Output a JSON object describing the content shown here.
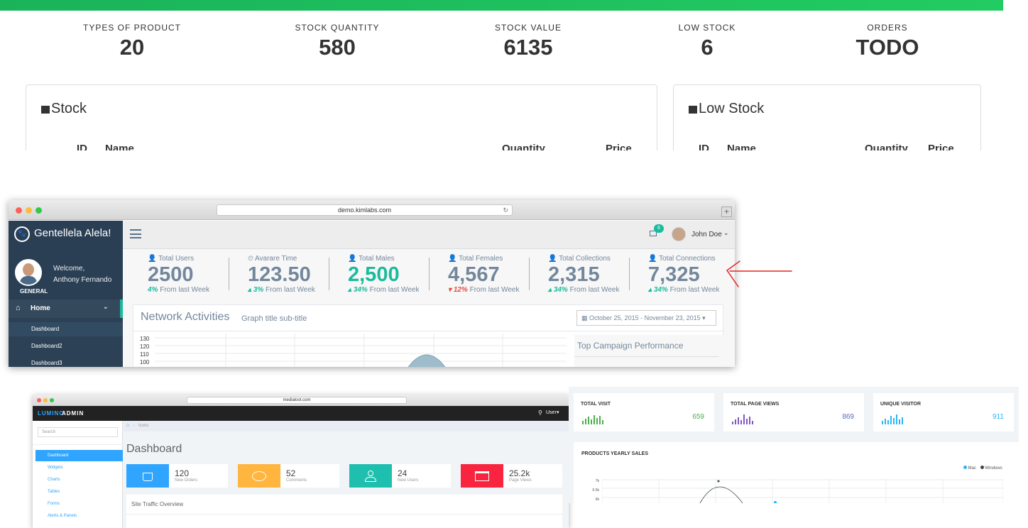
{
  "panel1": {
    "stats": [
      {
        "label": "TYPES OF PRODUCT",
        "value": "20"
      },
      {
        "label": "STOCK QUANTITY",
        "value": "580"
      },
      {
        "label": "STOCK VALUE",
        "value": "6135"
      },
      {
        "label": "LOW STOCK",
        "value": "6"
      },
      {
        "label": "ORDERS",
        "value": "TODO"
      }
    ],
    "stock_card": {
      "title": "Stock",
      "columns": [
        "ID",
        "Name",
        "Quantity",
        "Price"
      ]
    },
    "low_stock_card": {
      "title": "Low Stock",
      "columns": [
        "ID",
        "Name",
        "Quantity",
        "Price"
      ]
    },
    "colors": {
      "topbar": "#1ab35a"
    }
  },
  "panel2": {
    "url": "demo.kimlabs.com",
    "brand": "Gentellela Alela!",
    "welcome": "Welcome,",
    "user_name": "Anthony Fernando",
    "section": "GENERAL",
    "nav_home": "Home",
    "nav_items": [
      "Dashboard",
      "Dashboard2",
      "Dashboard3"
    ],
    "notif_count": "6",
    "top_user": "John Doe",
    "stats": [
      {
        "label": "Total Users",
        "value": "2500",
        "change": "4%",
        "suffix": "From last Week"
      },
      {
        "label": "Avarare Time",
        "value": "123.50",
        "change": "3%",
        "suffix": "From last Week"
      },
      {
        "label": "Total Males",
        "value": "2,500",
        "change": "34%",
        "suffix": "From last Week"
      },
      {
        "label": "Total Females",
        "value": "4,567",
        "change": "12%",
        "suffix": "From last Week"
      },
      {
        "label": "Total Collections",
        "value": "2,315",
        "change": "34%",
        "suffix": "From last Week"
      },
      {
        "label": "Total Connections",
        "value": "7,325",
        "change": "34%",
        "suffix": "From last Week"
      }
    ],
    "graph_title": "Network Activities",
    "graph_subtitle": "Graph title sub-title",
    "date_range": "October 25, 2015 - November 23, 2015",
    "y_ticks": [
      "130",
      "120",
      "110",
      "100"
    ],
    "campaign_title": "Top Campaign Performance",
    "colors": {
      "sidebar": "#2a3f54",
      "accent": "#1abb9c",
      "down": "#e74c3c"
    }
  },
  "panel3": {
    "url": "medialoot.com",
    "brand_a": "LUMINO",
    "brand_b": "ADMIN",
    "user": "User",
    "search_placeholder": "Search",
    "menu": [
      "Dashboard",
      "Widgets",
      "Charts",
      "Tables",
      "Forms",
      "Alerts & Panels"
    ],
    "breadcrumb": "Icons",
    "page_title": "Dashboard",
    "tiles": [
      {
        "value": "120",
        "label": "New Orders",
        "color": "#30a5ff"
      },
      {
        "value": "52",
        "label": "Comments",
        "color": "#ffb53e"
      },
      {
        "value": "24",
        "label": "New Users",
        "color": "#1ebfae"
      },
      {
        "value": "25.2k",
        "label": "Page Views",
        "color": "#f9243f"
      }
    ],
    "panel_title": "Site Traffic Overview"
  },
  "panel4": {
    "kpis": [
      {
        "label": "TOTAL VISIT",
        "value": "659",
        "color": "#4caf50"
      },
      {
        "label": "TOTAL PAGE VIEWS",
        "value": "869",
        "color": "#5c6bc0"
      },
      {
        "label": "UNIQUE VISITOR",
        "value": "911",
        "color": "#29b6f6"
      }
    ],
    "chart_title": "PRODUCTS YEARLY SALES",
    "legend": [
      "Mac",
      "Windows"
    ],
    "y_ticks": [
      "7k",
      "6.5k",
      "6k"
    ]
  }
}
